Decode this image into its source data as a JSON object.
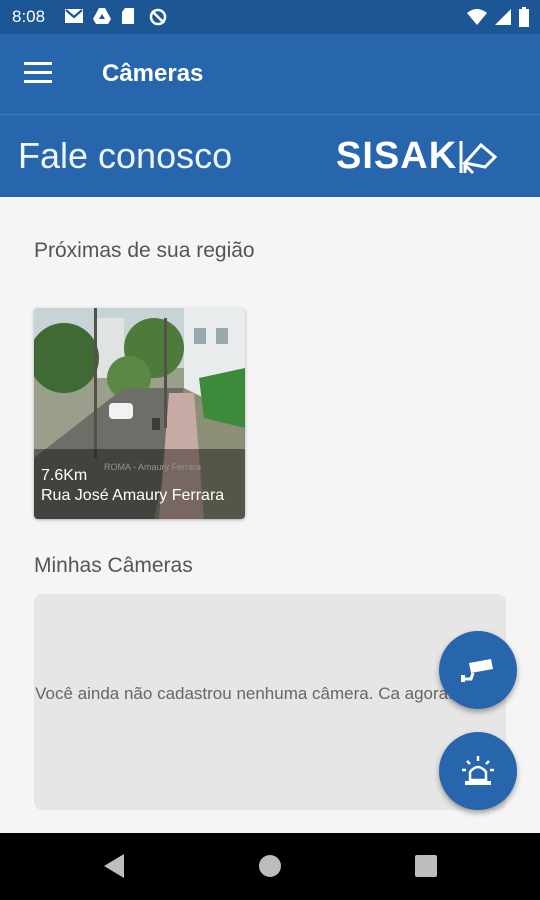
{
  "status_bar": {
    "time": "8:08",
    "left_icons": [
      "gmail-icon",
      "drive-icon",
      "sd-card-icon",
      "sync-off-icon"
    ],
    "right_icons": [
      "wifi-icon",
      "signal-icon",
      "battery-icon"
    ]
  },
  "app_bar": {
    "menu_icon": "hamburger-menu-icon",
    "title": "Câmeras"
  },
  "banner": {
    "contact_label": "Fale conosco",
    "brand": "SISAK"
  },
  "sections": {
    "nearby_title": "Próximas de sua região",
    "my_cameras_title": "Minhas Câmeras"
  },
  "nearby_cameras": [
    {
      "distance": "7.6Km",
      "address": "Rua José Amaury Ferrara",
      "watermark": "ROMA - Amaury Ferrara"
    }
  ],
  "my_cameras": {
    "empty_message": "Você ainda não cadastrou nenhuma câmera. Ca agora!"
  },
  "fabs": [
    {
      "icon": "security-camera-icon"
    },
    {
      "icon": "alarm-siren-icon"
    }
  ],
  "colors": {
    "status_bar": "#1d5694",
    "primary": "#2766ad",
    "background": "#f5f5f5",
    "empty_box": "#e6e6e6"
  }
}
